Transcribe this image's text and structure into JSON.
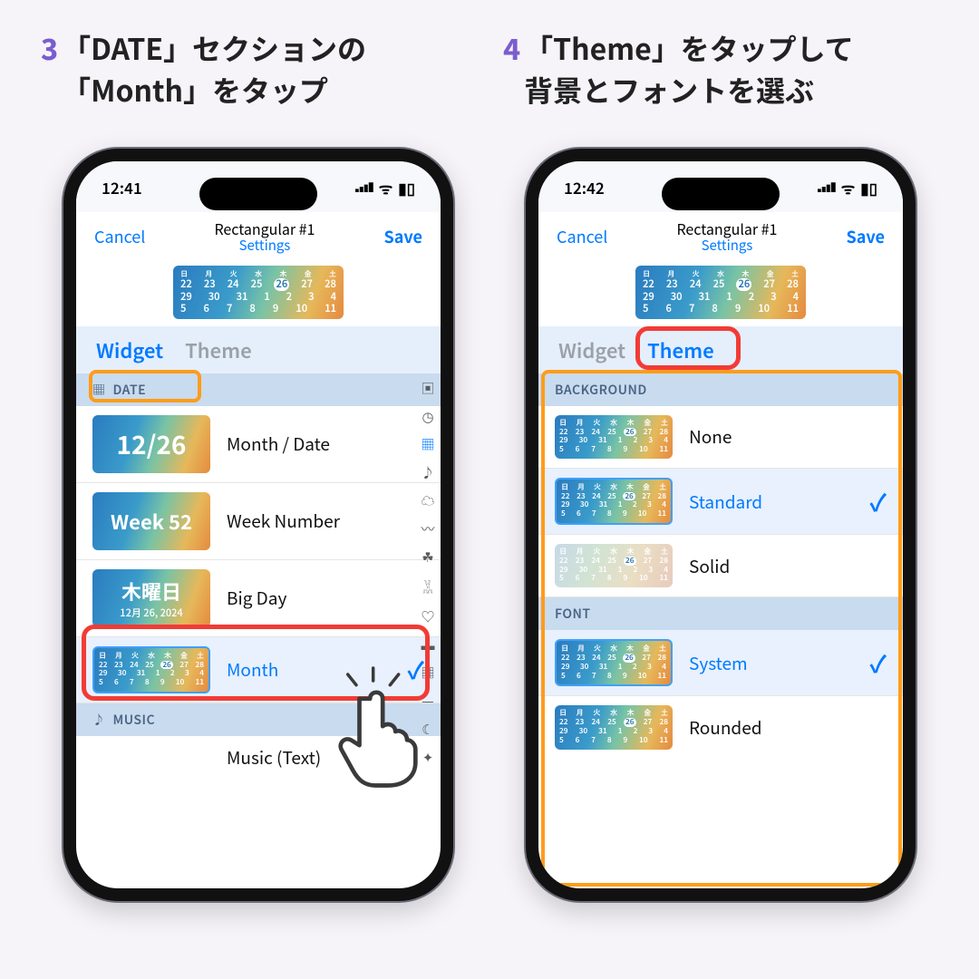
{
  "captions": {
    "step3_num": "3",
    "step3": "「DATE」セクションの\n「Month」をタップ",
    "step4_num": "4",
    "step4": "「Theme」をタップして\n背景とフォントを選ぶ"
  },
  "status": {
    "time_left": "12:41",
    "time_right": "12:42",
    "wifi": "􀙇",
    "battery": "􀛨"
  },
  "nav": {
    "cancel": "Cancel",
    "title": "Rectangular #1",
    "subtitle": "Settings",
    "save": "Save"
  },
  "tabs": {
    "widget": "Widget",
    "theme": "Theme"
  },
  "cal": {
    "dow": [
      "日",
      "月",
      "火",
      "水",
      "木",
      "金",
      "土"
    ],
    "row1": [
      "22",
      "23",
      "24",
      "25",
      "26",
      "27",
      "28"
    ],
    "row2": [
      "29",
      "30",
      "31",
      "1",
      "2",
      "3",
      "4"
    ],
    "row3": [
      "5",
      "6",
      "7",
      "8",
      "9",
      "10",
      "11"
    ]
  },
  "left": {
    "section_date": "DATE",
    "section_music": "MUSIC",
    "items": [
      {
        "badge": "12/26",
        "label": "Month / Date"
      },
      {
        "badge": "Week 52",
        "label": "Week Number"
      },
      {
        "day": "木曜日",
        "sub": "12月 26, 2024",
        "label": "Big Day"
      },
      {
        "cal": true,
        "label": "Month",
        "selected": true
      }
    ],
    "music_item": "Music (Text)"
  },
  "right": {
    "section_bg": "BACKGROUND",
    "section_font": "FONT",
    "bg": [
      {
        "label": "None"
      },
      {
        "label": "Standard",
        "selected": true
      },
      {
        "label": "Solid",
        "solid": true
      }
    ],
    "font": [
      {
        "label": "System",
        "selected": true
      },
      {
        "label": "Rounded"
      }
    ]
  },
  "side_icons": [
    "photo",
    "clock",
    "cal",
    "note",
    "cloud",
    "wind",
    "leaf",
    "walk",
    "heart",
    "batt",
    "calgrid",
    "bar",
    "moon",
    "spark"
  ]
}
